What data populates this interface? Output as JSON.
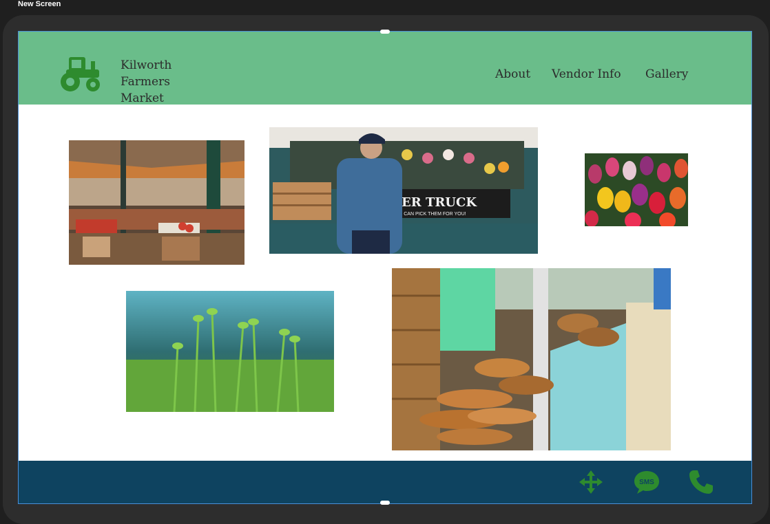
{
  "window": {
    "screen_label": "New Screen"
  },
  "header": {
    "logo_icon": "tractor-icon",
    "brand_lines": [
      "Kilworth",
      "Farmers",
      "Market"
    ],
    "nav": [
      {
        "label": "About"
      },
      {
        "label": "Vendor Info"
      },
      {
        "label": "Gallery"
      }
    ]
  },
  "gallery": {
    "photos": [
      {
        "subject": "market-stalls-photo"
      },
      {
        "subject": "flower-truck-photo",
        "sign_text": "ER TRUCK",
        "sign_subtext": "WE CAN PICK THEM FOR YOU!"
      },
      {
        "subject": "tulips-photo"
      },
      {
        "subject": "seedlings-photo"
      },
      {
        "subject": "bread-stall-photo"
      }
    ]
  },
  "footer": {
    "icons": [
      "move-icon",
      "sms-icon",
      "phone-icon"
    ],
    "sms_text": "SMS"
  },
  "colors": {
    "header_bg": "#6abd8a",
    "footer_bg": "#0e4360",
    "icon_green": "#2e8b2e",
    "logo_green": "#2e8b2e"
  }
}
